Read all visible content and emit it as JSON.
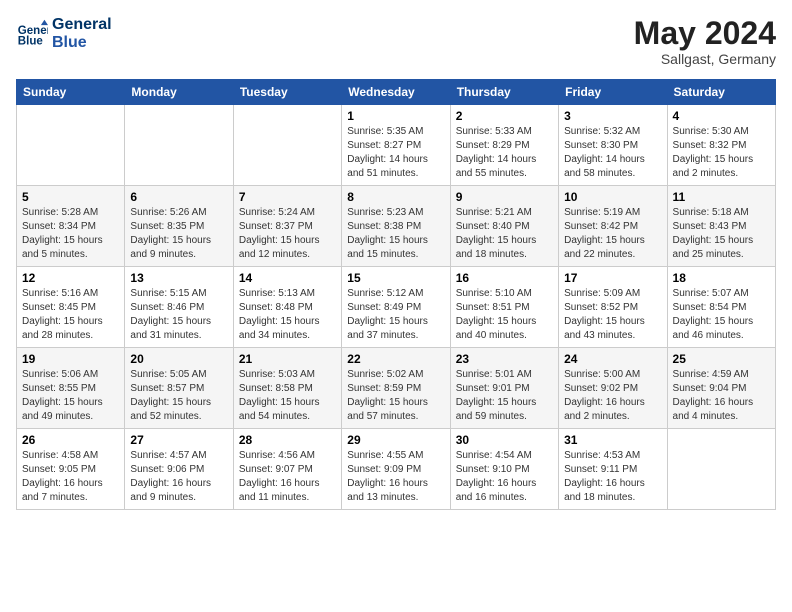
{
  "header": {
    "logo_line1": "General",
    "logo_line2": "Blue",
    "month_year": "May 2024",
    "location": "Sallgast, Germany"
  },
  "weekdays": [
    "Sunday",
    "Monday",
    "Tuesday",
    "Wednesday",
    "Thursday",
    "Friday",
    "Saturday"
  ],
  "weeks": [
    [
      {
        "day": "",
        "info": ""
      },
      {
        "day": "",
        "info": ""
      },
      {
        "day": "",
        "info": ""
      },
      {
        "day": "1",
        "info": "Sunrise: 5:35 AM\nSunset: 8:27 PM\nDaylight: 14 hours\nand 51 minutes."
      },
      {
        "day": "2",
        "info": "Sunrise: 5:33 AM\nSunset: 8:29 PM\nDaylight: 14 hours\nand 55 minutes."
      },
      {
        "day": "3",
        "info": "Sunrise: 5:32 AM\nSunset: 8:30 PM\nDaylight: 14 hours\nand 58 minutes."
      },
      {
        "day": "4",
        "info": "Sunrise: 5:30 AM\nSunset: 8:32 PM\nDaylight: 15 hours\nand 2 minutes."
      }
    ],
    [
      {
        "day": "5",
        "info": "Sunrise: 5:28 AM\nSunset: 8:34 PM\nDaylight: 15 hours\nand 5 minutes."
      },
      {
        "day": "6",
        "info": "Sunrise: 5:26 AM\nSunset: 8:35 PM\nDaylight: 15 hours\nand 9 minutes."
      },
      {
        "day": "7",
        "info": "Sunrise: 5:24 AM\nSunset: 8:37 PM\nDaylight: 15 hours\nand 12 minutes."
      },
      {
        "day": "8",
        "info": "Sunrise: 5:23 AM\nSunset: 8:38 PM\nDaylight: 15 hours\nand 15 minutes."
      },
      {
        "day": "9",
        "info": "Sunrise: 5:21 AM\nSunset: 8:40 PM\nDaylight: 15 hours\nand 18 minutes."
      },
      {
        "day": "10",
        "info": "Sunrise: 5:19 AM\nSunset: 8:42 PM\nDaylight: 15 hours\nand 22 minutes."
      },
      {
        "day": "11",
        "info": "Sunrise: 5:18 AM\nSunset: 8:43 PM\nDaylight: 15 hours\nand 25 minutes."
      }
    ],
    [
      {
        "day": "12",
        "info": "Sunrise: 5:16 AM\nSunset: 8:45 PM\nDaylight: 15 hours\nand 28 minutes."
      },
      {
        "day": "13",
        "info": "Sunrise: 5:15 AM\nSunset: 8:46 PM\nDaylight: 15 hours\nand 31 minutes."
      },
      {
        "day": "14",
        "info": "Sunrise: 5:13 AM\nSunset: 8:48 PM\nDaylight: 15 hours\nand 34 minutes."
      },
      {
        "day": "15",
        "info": "Sunrise: 5:12 AM\nSunset: 8:49 PM\nDaylight: 15 hours\nand 37 minutes."
      },
      {
        "day": "16",
        "info": "Sunrise: 5:10 AM\nSunset: 8:51 PM\nDaylight: 15 hours\nand 40 minutes."
      },
      {
        "day": "17",
        "info": "Sunrise: 5:09 AM\nSunset: 8:52 PM\nDaylight: 15 hours\nand 43 minutes."
      },
      {
        "day": "18",
        "info": "Sunrise: 5:07 AM\nSunset: 8:54 PM\nDaylight: 15 hours\nand 46 minutes."
      }
    ],
    [
      {
        "day": "19",
        "info": "Sunrise: 5:06 AM\nSunset: 8:55 PM\nDaylight: 15 hours\nand 49 minutes."
      },
      {
        "day": "20",
        "info": "Sunrise: 5:05 AM\nSunset: 8:57 PM\nDaylight: 15 hours\nand 52 minutes."
      },
      {
        "day": "21",
        "info": "Sunrise: 5:03 AM\nSunset: 8:58 PM\nDaylight: 15 hours\nand 54 minutes."
      },
      {
        "day": "22",
        "info": "Sunrise: 5:02 AM\nSunset: 8:59 PM\nDaylight: 15 hours\nand 57 minutes."
      },
      {
        "day": "23",
        "info": "Sunrise: 5:01 AM\nSunset: 9:01 PM\nDaylight: 15 hours\nand 59 minutes."
      },
      {
        "day": "24",
        "info": "Sunrise: 5:00 AM\nSunset: 9:02 PM\nDaylight: 16 hours\nand 2 minutes."
      },
      {
        "day": "25",
        "info": "Sunrise: 4:59 AM\nSunset: 9:04 PM\nDaylight: 16 hours\nand 4 minutes."
      }
    ],
    [
      {
        "day": "26",
        "info": "Sunrise: 4:58 AM\nSunset: 9:05 PM\nDaylight: 16 hours\nand 7 minutes."
      },
      {
        "day": "27",
        "info": "Sunrise: 4:57 AM\nSunset: 9:06 PM\nDaylight: 16 hours\nand 9 minutes."
      },
      {
        "day": "28",
        "info": "Sunrise: 4:56 AM\nSunset: 9:07 PM\nDaylight: 16 hours\nand 11 minutes."
      },
      {
        "day": "29",
        "info": "Sunrise: 4:55 AM\nSunset: 9:09 PM\nDaylight: 16 hours\nand 13 minutes."
      },
      {
        "day": "30",
        "info": "Sunrise: 4:54 AM\nSunset: 9:10 PM\nDaylight: 16 hours\nand 16 minutes."
      },
      {
        "day": "31",
        "info": "Sunrise: 4:53 AM\nSunset: 9:11 PM\nDaylight: 16 hours\nand 18 minutes."
      },
      {
        "day": "",
        "info": ""
      }
    ]
  ]
}
